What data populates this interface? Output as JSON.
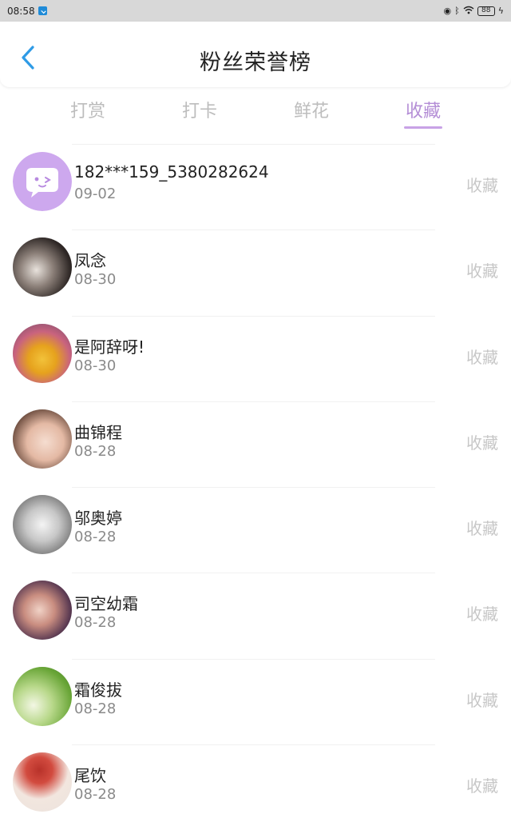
{
  "status_bar": {
    "time": "08:58",
    "battery": "88",
    "icons": [
      "eye-icon",
      "bluetooth-icon",
      "wifi-icon",
      "battery-icon",
      "charging-icon"
    ]
  },
  "header": {
    "title": "粉丝荣誉榜",
    "back_icon": "chevron-left-icon"
  },
  "tabs": [
    {
      "label": "打赏",
      "active": false
    },
    {
      "label": "打卡",
      "active": false
    },
    {
      "label": "鲜花",
      "active": false
    },
    {
      "label": "收藏",
      "active": true
    }
  ],
  "colors": {
    "accent": "#b48ed6",
    "tab_inactive": "#bdbdbd",
    "action_text": "#c7c7c7"
  },
  "fans": [
    {
      "name": "182***159_5380282624",
      "date": "09-02",
      "action": "收藏",
      "avatar": "default-chat-bubble-avatar"
    },
    {
      "name": "凤念",
      "date": "08-30",
      "action": "收藏",
      "avatar": "user-photo-avatar"
    },
    {
      "name": "是阿辞呀!",
      "date": "08-30",
      "action": "收藏",
      "avatar": "user-photo-avatar"
    },
    {
      "name": "曲锦程",
      "date": "08-28",
      "action": "收藏",
      "avatar": "user-photo-avatar"
    },
    {
      "name": "邬奥婷",
      "date": "08-28",
      "action": "收藏",
      "avatar": "user-photo-avatar"
    },
    {
      "name": "司空幼霜",
      "date": "08-28",
      "action": "收藏",
      "avatar": "user-photo-avatar"
    },
    {
      "name": "霜俊拔",
      "date": "08-28",
      "action": "收藏",
      "avatar": "user-photo-avatar"
    },
    {
      "name": "尾饮",
      "date": "08-28",
      "action": "收藏",
      "avatar": "user-photo-avatar"
    }
  ]
}
